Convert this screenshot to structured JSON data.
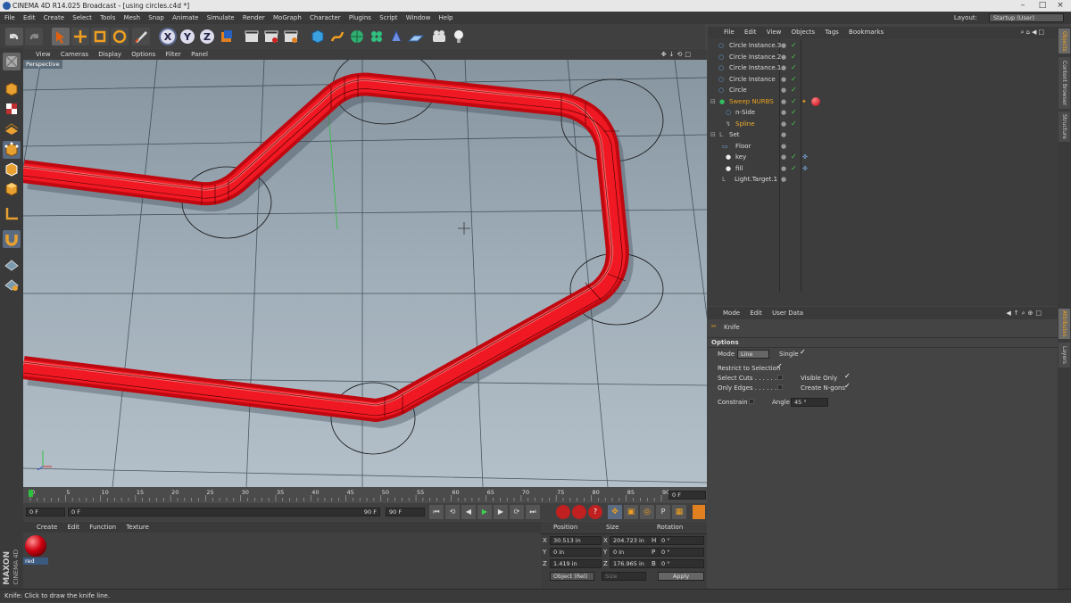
{
  "window": {
    "title": "CINEMA 4D R14.025 Broadcast - [using circles.c4d *]"
  },
  "menu": [
    "File",
    "Edit",
    "Create",
    "Select",
    "Tools",
    "Mesh",
    "Snap",
    "Animate",
    "Simulate",
    "Render",
    "MoGraph",
    "Character",
    "Plugins",
    "Script",
    "Window",
    "Help"
  ],
  "layout": {
    "label": "Layout:",
    "value": "Startup (User)"
  },
  "viewport": {
    "menu": [
      "View",
      "Cameras",
      "Display",
      "Options",
      "Filter",
      "Panel"
    ],
    "label": "Perspective"
  },
  "timeline": {
    "ticks": [
      "0",
      "5",
      "10",
      "15",
      "20",
      "25",
      "30",
      "35",
      "40",
      "45",
      "50",
      "55",
      "60",
      "65",
      "70",
      "75",
      "80",
      "85",
      "90"
    ],
    "current_frame": "0 F",
    "start": "0 F",
    "range_start": "0 F",
    "range_end": "90 F",
    "end": "90 F"
  },
  "material_manager": {
    "menu": [
      "Create",
      "Edit",
      "Function",
      "Texture"
    ],
    "materials": [
      {
        "name": "red"
      }
    ]
  },
  "coordinates": {
    "headers": {
      "position": "Position",
      "size": "Size",
      "rotation": "Rotation"
    },
    "rows": [
      {
        "axis": "X",
        "pos": "30.513 in",
        "size_axis": "X",
        "size": "204.723 in",
        "rot_axis": "H",
        "rot": "0 °"
      },
      {
        "axis": "Y",
        "pos": "0 in",
        "size_axis": "Y",
        "size": "0 in",
        "rot_axis": "P",
        "rot": "0 °"
      },
      {
        "axis": "Z",
        "pos": "1.419 in",
        "size_axis": "Z",
        "size": "176.965 in",
        "rot_axis": "B",
        "rot": "0 °"
      }
    ],
    "mode": "Object (Rel)",
    "size_mode": "Size",
    "apply": "Apply"
  },
  "brand": {
    "line1": "MAXON",
    "line2": "CINEMA 4D"
  },
  "status": "Knife: Click to draw the knife line.",
  "object_manager": {
    "menu": [
      "File",
      "Edit",
      "View",
      "Objects",
      "Tags",
      "Bookmarks"
    ],
    "objects": [
      {
        "name": "Circle Instance.3",
        "color": "#cfcfcf"
      },
      {
        "name": "Circle Instance.2",
        "color": "#cfcfcf"
      },
      {
        "name": "Circle Instance.1",
        "color": "#cfcfcf"
      },
      {
        "name": "Circle Instance",
        "color": "#cfcfcf"
      },
      {
        "name": "Circle",
        "color": "#cfcfcf"
      },
      {
        "name": "Sweep NURBS",
        "color": "#e8a020"
      },
      {
        "name": "n-Side",
        "color": "#cfcfcf"
      },
      {
        "name": "Spline",
        "color": "#f0b030"
      },
      {
        "name": "Set",
        "color": "#cfcfcf"
      },
      {
        "name": "Floor",
        "color": "#cfcfcf"
      },
      {
        "name": "key",
        "color": "#cfcfcf"
      },
      {
        "name": "fill",
        "color": "#cfcfcf"
      },
      {
        "name": "Light.Target.1",
        "color": "#cfcfcf"
      }
    ]
  },
  "attribute_manager": {
    "menu": [
      "Mode",
      "Edit",
      "User Data"
    ],
    "tool": "Knife",
    "section": "Options",
    "mode_label": "Mode",
    "mode_value": "Line",
    "single_label": "Single",
    "restrict_label": "Restrict to Selection",
    "select_cuts_label": "Select Cuts . . . . . . .",
    "visible_only_label": "Visible Only",
    "only_edges_label": "Only Edges . . . . . . .",
    "create_ngons_label": "Create N-gons",
    "constrain_label": "Constrain",
    "angle_label": "Angle",
    "angle_value": "45 °"
  },
  "side_tabs": [
    "Objects",
    "Content Browser",
    "Structure",
    "Attributes",
    "Layers"
  ],
  "colors": {
    "accent": "#e0101a",
    "bg": "#444444"
  }
}
